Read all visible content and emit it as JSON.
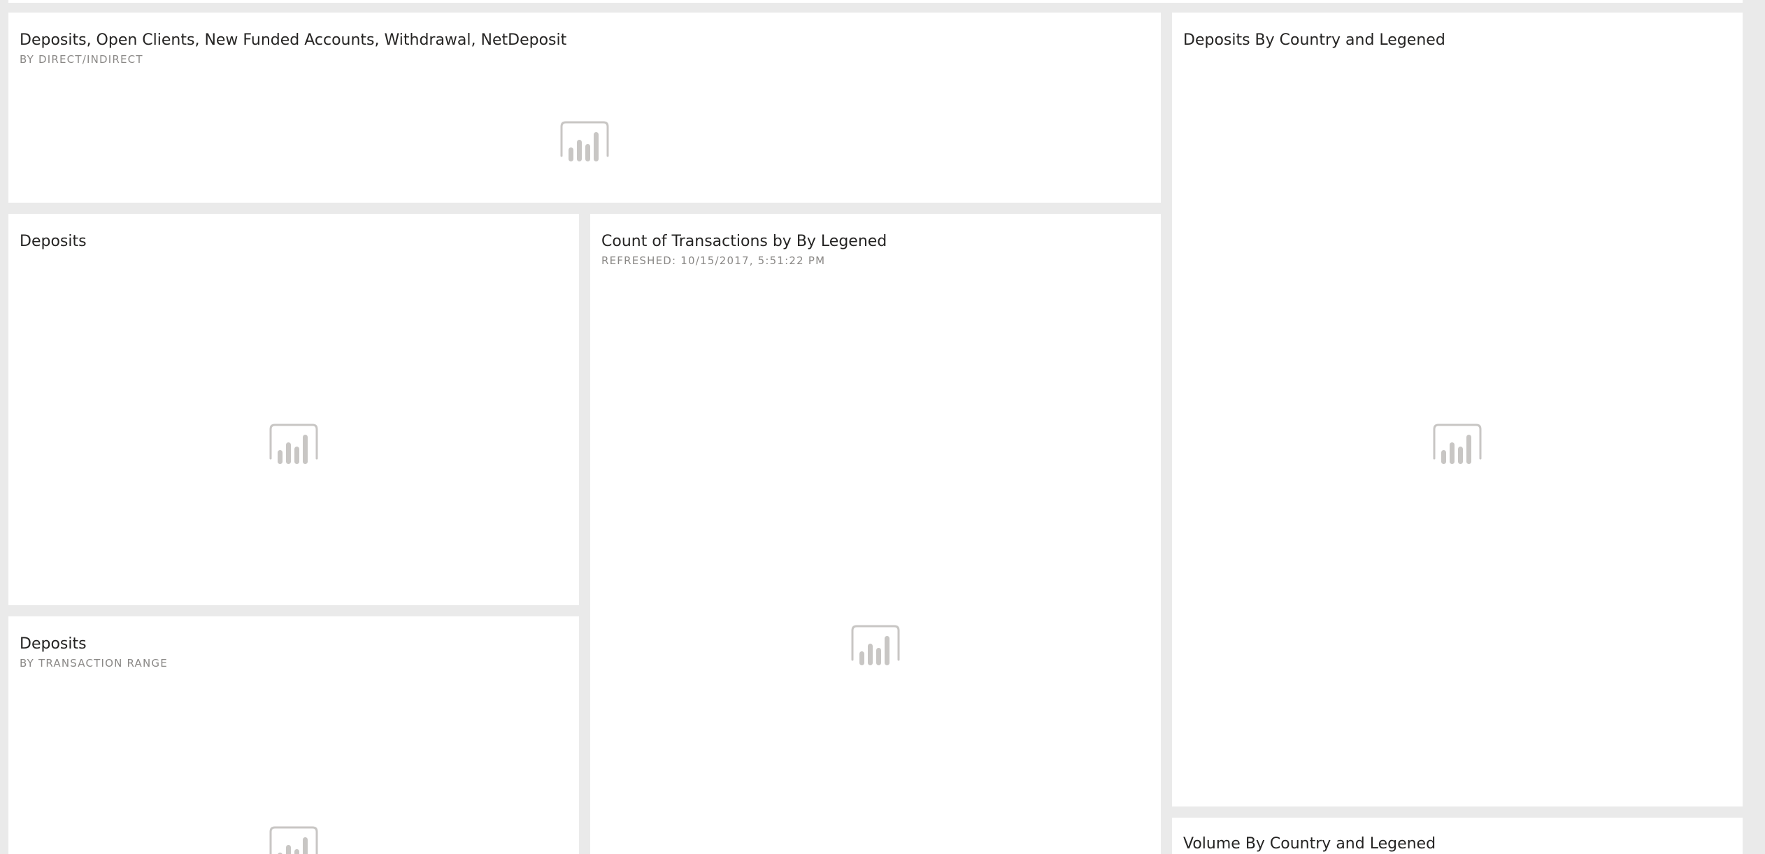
{
  "dashboard": {
    "tiles": [
      {
        "title": "Deposits, Open Clients, New Funded Accounts, Withdrawal, NetDeposit",
        "subtitle": "BY DIRECT/INDIRECT",
        "icon": "chart-placeholder-icon"
      },
      {
        "title": "Deposits By Country and Legened",
        "subtitle": "",
        "icon": "chart-placeholder-icon"
      },
      {
        "title": "Deposits",
        "subtitle": "",
        "icon": "chart-placeholder-icon"
      },
      {
        "title": "Count of Transactions by By Legened",
        "subtitle": "REFRESHED: 10/15/2017, 5:51:22 PM",
        "icon": "chart-placeholder-icon"
      },
      {
        "title": "Deposits",
        "subtitle": "BY TRANSACTION RANGE",
        "icon": "chart-placeholder-icon"
      },
      {
        "title": "Volume By Country and Legened",
        "subtitle": "",
        "icon": "chart-placeholder-icon"
      }
    ]
  },
  "colors": {
    "background": "#eaeaea",
    "tile": "#ffffff",
    "title_text": "#252423",
    "subtitle_text": "#8a8886",
    "placeholder_icon": "#c8c6c4"
  }
}
